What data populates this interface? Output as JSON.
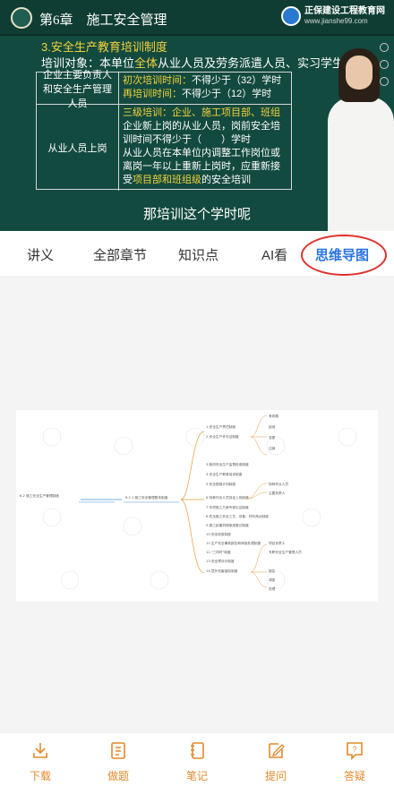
{
  "video": {
    "chapter_title": "第6章　施工安全管理",
    "brand_name": "正保建设工程教育网",
    "brand_url": "www.jianshe99.com",
    "heading": "3.安全生产教育培训制度",
    "target_prefix": "培训对象：本单位",
    "target_highlight": "全体",
    "target_suffix": "从业人员及劳务派遣人员、实习学生",
    "table": {
      "row1_left": "企业主要负责人和安全生产管理人员",
      "row1_line1_a": "初次培训时间：",
      "row1_line1_b": "不得少于（32）学时",
      "row1_line2_a": "再培训时间：",
      "row1_line2_b": "不得少于（12）学时",
      "row2_left": "从业人员上岗",
      "row2_line1": "三级培训：企业、施工项目部、班组",
      "row2_line2": "企业新上岗的从业人员，岗前安全培训时间不得少于（　　）学时",
      "row2_line3_a": "从业人员在本单位内调整工作岗位或离岗一年以上重新上岗时，应重新接受",
      "row2_line3_b": "项目部和班组级",
      "row2_line3_c": "的安全培训"
    },
    "subtitle": "那培训这个学时呢"
  },
  "tabs": [
    {
      "label": "讲义"
    },
    {
      "label": "全部章节"
    },
    {
      "label": "知识点"
    },
    {
      "label": "AI看"
    },
    {
      "label": "思维导图"
    }
  ],
  "active_tab": "思维导图",
  "mindmap": {
    "root": "6.2 施工安全生产管理制度",
    "center": "6.2.1 施工安全管理基本制度",
    "branches": [
      "1.安全生产责任制度",
      "2.安全生产许可证制度",
      "3.政府安全生产监督检查制度",
      "4.安全生产教育培训制度",
      "5.安全措施计划制度",
      "6.特种作业人员持证上岗制度",
      "7.专项施工方案专家论证制度",
      "8.危及施工安全工艺、设备、材料淘汰制度",
      "9.施工起重机械使用登记制度",
      "10.安全检查制度",
      "11.生产安全事故报告和调查处理制度",
      "12.\"三同时\"制度",
      "13.安全预评价制度",
      "14.意外伤害保险制度"
    ],
    "leaves": [
      "有效期",
      "延续",
      "变更",
      "注销",
      "特种作业人员",
      "主要负责人",
      "项目负责人",
      "专职安全生产管理人员",
      "报告",
      "调查",
      "处理"
    ]
  },
  "bottom_nav": [
    {
      "label": "下载",
      "icon": "download-icon"
    },
    {
      "label": "做题",
      "icon": "practice-icon"
    },
    {
      "label": "笔记",
      "icon": "notes-icon"
    },
    {
      "label": "提问",
      "icon": "ask-icon"
    },
    {
      "label": "答疑",
      "icon": "qa-icon"
    }
  ],
  "colors": {
    "accent_blue": "#2a74e0",
    "highlight_ring": "#e0302a",
    "nav_orange": "#e18a2c",
    "slide_green": "#134a3f",
    "slide_yellow": "#f3d23a"
  }
}
